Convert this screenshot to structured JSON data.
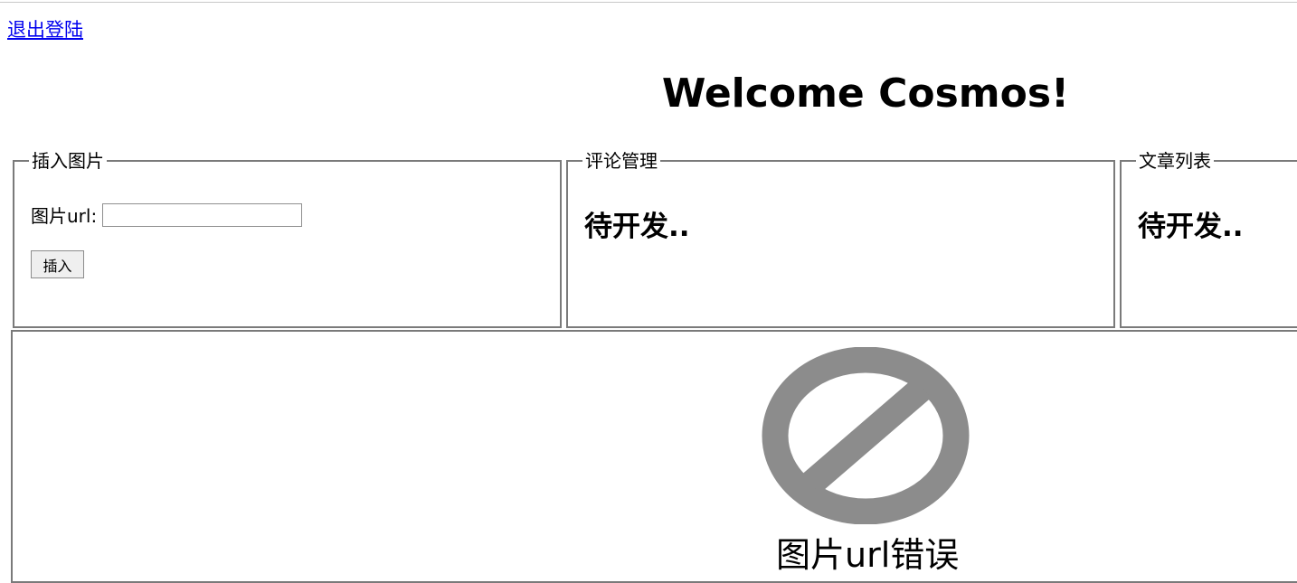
{
  "header": {
    "logout_link": "退出登陆",
    "title": "Welcome Cosmos!"
  },
  "panels": {
    "insert_image": {
      "legend": "插入图片",
      "url_label": "图片url:",
      "url_value": "",
      "insert_button": "插入"
    },
    "comment_management": {
      "legend": "评论管理",
      "status": "待开发.."
    },
    "article_list": {
      "legend": "文章列表",
      "status": "待开发.."
    }
  },
  "preview": {
    "broken_icon": "no-entry-icon",
    "error_text": "图片url错误",
    "icon_color": "#8c8c8c"
  },
  "colors": {
    "link": "#0000ee",
    "border": "#7a7a7a"
  }
}
